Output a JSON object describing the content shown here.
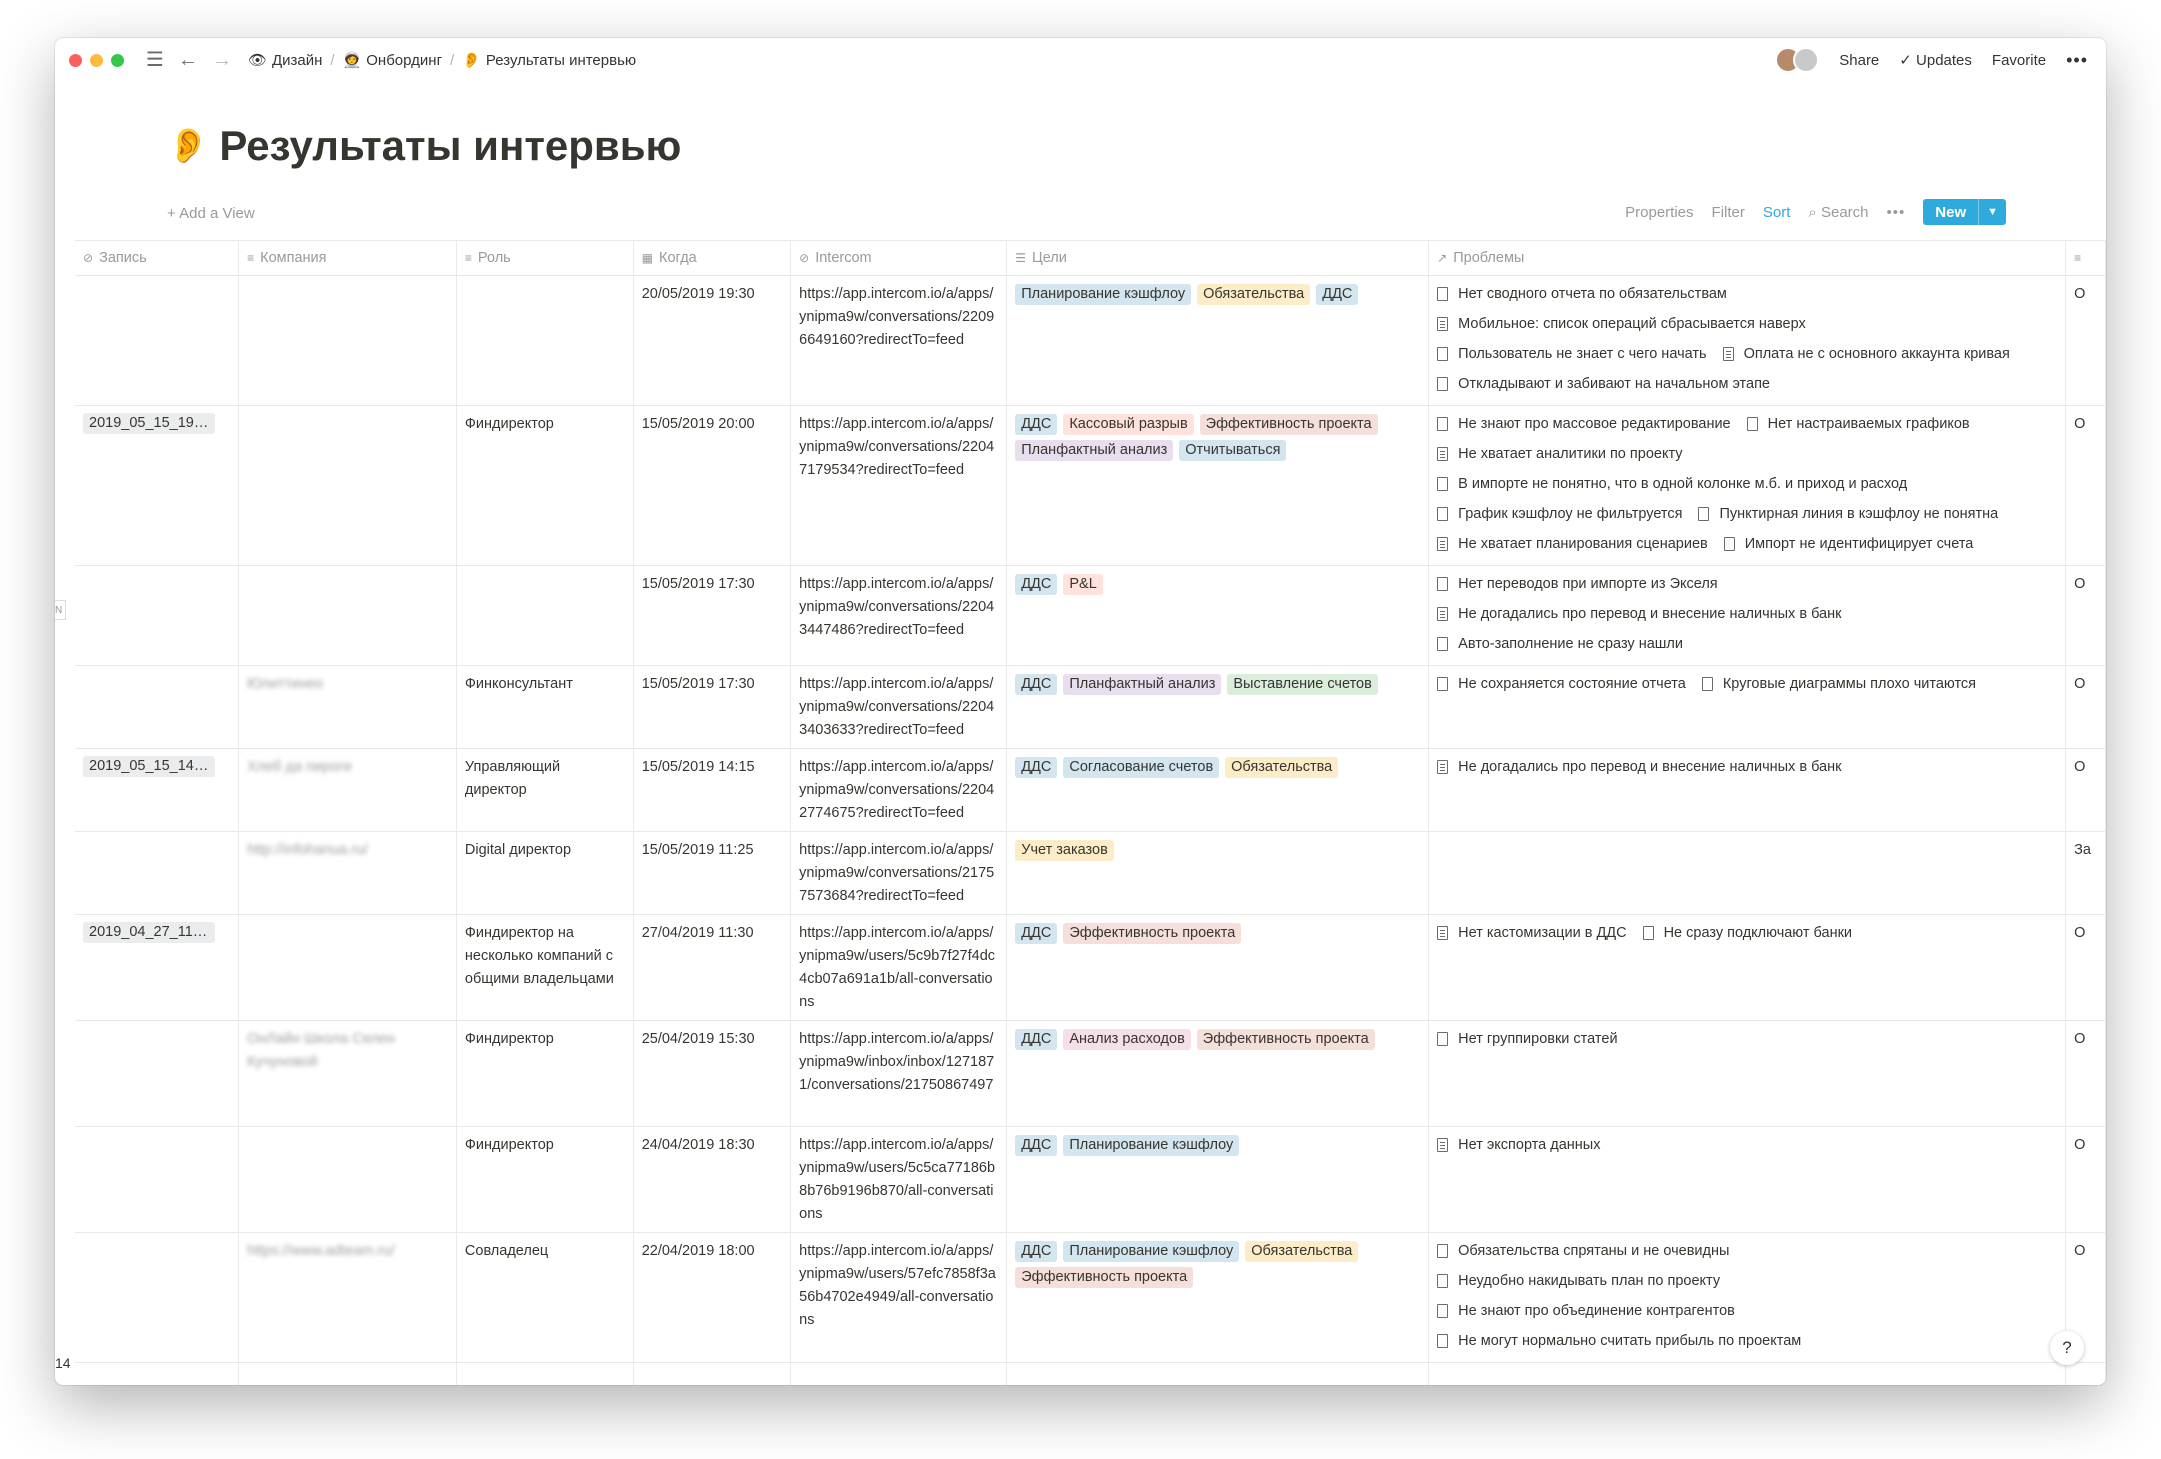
{
  "breadcrumb": {
    "items": [
      {
        "emoji": "👁",
        "label": "Дизайн"
      },
      {
        "emoji": "🧑‍🚀",
        "label": "Онбординг"
      },
      {
        "emoji": "👂",
        "label": "Результаты интервью"
      }
    ]
  },
  "topbar": {
    "share": "Share",
    "updates": "Updates",
    "favorite": "Favorite"
  },
  "page": {
    "emoji": "👂",
    "title": "Результаты интервью"
  },
  "view": {
    "add_view": "Add a View",
    "properties": "Properties",
    "filter": "Filter",
    "sort": "Sort",
    "search": "Search",
    "new": "New"
  },
  "columns": [
    "Запись",
    "Компания",
    "Роль",
    "Когда",
    "Intercom",
    "Цели",
    "Проблемы"
  ],
  "tag_colors": {
    "Планирование кэшфлоу": "#d3e5ef",
    "Обязательства": "#fdecc8",
    "ДДС": "#d3e5ef",
    "Кассовый разрыв": "#ffe2dd",
    "Эффективность проекта": "#f4dfdb",
    "Планфактный анализ": "#e8deee",
    "Отчитываться": "#d3e5ef",
    "P&L": "#ffe2dd",
    "Выставление счетов": "#dbeddb",
    "Согласование счетов": "#d3e5ef",
    "Учет заказов": "#fdecc8",
    "Анализ расходов": "#f5e0e9"
  },
  "rows": [
    {
      "rec": "",
      "company": "",
      "role": "",
      "when": "20/05/2019 19:30",
      "url": "https://app.intercom.io/a/apps/ynipma9w/conversations/22096649160?redirectTo=feed",
      "tags": [
        "Планирование кэшфлоу",
        "Обязательства",
        "ДДС"
      ],
      "problems": [
        [
          "Нет сводного отчета по обязательствам"
        ],
        [
          "Мобильное: список операций сбрасывается наверх"
        ],
        [
          "Пользователь не знает с чего начать",
          "Оплата не с основного аккаунта кривая"
        ],
        [
          "Откладывают и забивают на начальном этапе"
        ]
      ],
      "edge": "О"
    },
    {
      "rec": "2019_05_15_19_...",
      "company": "",
      "role": "Финдиректор",
      "when": "15/05/2019 20:00",
      "url": "https://app.intercom.io/a/apps/ynipma9w/conversations/22047179534?redirectTo=feed",
      "tags": [
        "ДДС",
        "Кассовый разрыв",
        "Эффективность проекта",
        "Планфактный анализ",
        "Отчитываться"
      ],
      "problems": [
        [
          "Не знают про массовое редактирование",
          "Нет настраиваемых графиков"
        ],
        [
          "Не хватает аналитики по проекту"
        ],
        [
          "В импорте не понятно, что в одной колонке м.б. и приход и расход"
        ],
        [
          "График кэшфлоу не фильтруется",
          "Пунктирная линия в кэшфлоу не понятна"
        ],
        [
          "Не хватает планирования сценариев",
          "Импорт не идентифицирует счета"
        ]
      ],
      "edge": "О"
    },
    {
      "rec": "",
      "company": "",
      "role": "",
      "when": "15/05/2019 17:30",
      "url": "https://app.intercom.io/a/apps/ynipma9w/conversations/22043447486?redirectTo=feed",
      "tags": [
        "ДДС",
        "P&L"
      ],
      "problems": [
        [
          "Нет переводов при импорте из Экселя"
        ],
        [
          "Не догадались про перевод и внесение наличных в банк"
        ],
        [
          "Авто-заполнение не сразу нашли"
        ]
      ],
      "edge": "О"
    },
    {
      "rec": "",
      "company": "Юлиттинео",
      "role": "Финконсультант",
      "when": "15/05/2019 17:30",
      "url": "https://app.intercom.io/a/apps/ynipma9w/conversations/22043403633?redirectTo=feed",
      "tags": [
        "ДДС",
        "Планфактный анализ",
        "Выставление счетов"
      ],
      "problems": [
        [
          "Не сохраняется состояние отчета",
          "Круговые диаграммы плохо читаются"
        ]
      ],
      "edge": "О"
    },
    {
      "rec": "2019_05_15_14_1...",
      "company": "Хлеб да пироги",
      "role": "Управляющий директор",
      "when": "15/05/2019 14:15",
      "url": "https://app.intercom.io/a/apps/ynipma9w/conversations/22042774675?redirectTo=feed",
      "tags": [
        "ДДС",
        "Согласование счетов",
        "Обязательства"
      ],
      "problems": [
        [
          "Не догадались про перевод и внесение наличных в банк"
        ]
      ],
      "edge": "О"
    },
    {
      "rec": "",
      "company": "http://infohanua.ru/",
      "role": "Digital директор",
      "when": "15/05/2019 11:25",
      "url": "https://app.intercom.io/a/apps/ynipma9w/conversations/21757573684?redirectTo=feed",
      "tags": [
        "Учет заказов"
      ],
      "problems": [],
      "edge": "За"
    },
    {
      "rec": "2019_04_27_11_1...",
      "company": "",
      "role": "Финдиректор на несколько компаний с общими владельцами",
      "when": "27/04/2019 11:30",
      "url": "https://app.intercom.io/a/apps/ynipma9w/users/5c9b7f27f4dc4cb07a691a1b/all-conversations",
      "tags": [
        "ДДС",
        "Эффективность проекта"
      ],
      "problems": [
        [
          "Нет кастомизации в ДДС",
          "Не сразу подключают банки"
        ]
      ],
      "edge": "О"
    },
    {
      "rec": "",
      "company": "ОнЛайн Школа Селен Кучуновой",
      "role": "Финдиректор",
      "when": "25/04/2019 15:30",
      "url": "https://app.intercom.io/a/apps/ynipma9w/inbox/inbox/1271871/conversations/21750867497",
      "tags": [
        "ДДС",
        "Анализ расходов",
        "Эффективность проекта"
      ],
      "problems": [
        [
          "Нет группировки статей"
        ]
      ],
      "edge": "О"
    },
    {
      "rec": "",
      "company": "",
      "role": "Финдиректор",
      "when": "24/04/2019 18:30",
      "url": "https://app.intercom.io/a/apps/ynipma9w/users/5c5ca77186b8b76b9196b870/all-conversations",
      "tags": [
        "ДДС",
        "Планирование кэшфлоу"
      ],
      "problems": [
        [
          "Нет экспорта данных"
        ]
      ],
      "edge": "О"
    },
    {
      "rec": "",
      "company": "https://www.adteam.ru/",
      "role": "Совладелец",
      "when": "22/04/2019 18:00",
      "url": "https://app.intercom.io/a/apps/ynipma9w/users/57efc7858f3a56b4702e4949/all-conversations",
      "tags": [
        "ДДС",
        "Планирование кэшфлоу",
        "Обязательства",
        "Эффективность проекта"
      ],
      "problems": [
        [
          "Обязательства спрятаны и не очевидны"
        ],
        [
          "Неудобно накидывать план по проекту"
        ],
        [
          "Не знают про объединение контрагентов"
        ],
        [
          "Не могут нормально считать прибыль по проектам"
        ]
      ],
      "edge": "О"
    }
  ],
  "footer": {
    "count": "14",
    "help": "?"
  }
}
